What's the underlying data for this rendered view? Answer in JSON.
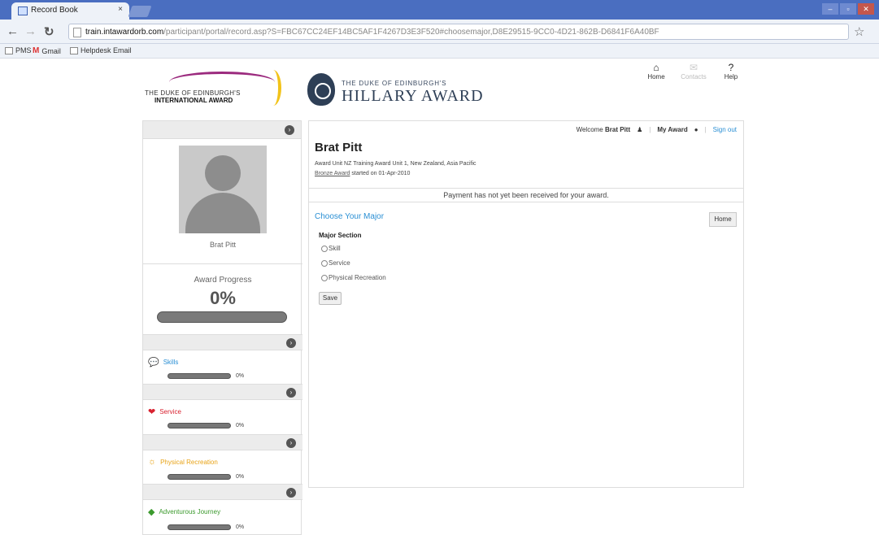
{
  "browser": {
    "tab_title": "Record Book",
    "tab_close": "×",
    "url_domain": "train.intawardorb.com",
    "url_path": "/participant/portal/record.asp?S=FBC67CC24EF14BC5AF1F4267D3E3F520#choosemajor,D8E29515-9CC0-4D21-862B-D6841F6A40BF",
    "bookmarks": [
      "PMS",
      "Gmail",
      "Helpdesk Email"
    ],
    "window_controls": [
      "–",
      "▫",
      "✕"
    ]
  },
  "header": {
    "left_logo_line1": "THE DUKE OF EDINBURGH'S",
    "left_logo_line2": "INTERNATIONAL AWARD",
    "right_logo_small": "THE DUKE OF EDINBURGH'S",
    "right_logo_big": "HILLARY AWARD",
    "nav": [
      {
        "label": "Home",
        "icon": "home-icon",
        "glyph": "⌂"
      },
      {
        "label": "Contacts",
        "icon": "contacts-icon",
        "glyph": "✉"
      },
      {
        "label": "Help",
        "icon": "help-icon",
        "glyph": "?"
      }
    ]
  },
  "sidebar": {
    "name": "Brat Pitt",
    "progress_title": "Award Progress",
    "progress_value": "0%",
    "progress_fraction": 0,
    "sections": [
      {
        "label": "Skills",
        "pct": "0%",
        "color": "#2a8fd4",
        "icon": "skills-icon",
        "glyph": "💬"
      },
      {
        "label": "Service",
        "pct": "0%",
        "color": "#d8212f",
        "icon": "service-icon",
        "glyph": "❤"
      },
      {
        "label": "Physical Recreation",
        "pct": "0%",
        "color": "#e8a317",
        "icon": "physical-recreation-icon",
        "glyph": "☼"
      },
      {
        "label": "Adventurous Journey",
        "pct": "0%",
        "color": "#3c9a2e",
        "icon": "adventurous-journey-icon",
        "glyph": "◆"
      }
    ]
  },
  "main": {
    "welcome_prefix": "Welcome",
    "welcome_name": "Brat Pitt",
    "my_award": "My Award",
    "sign_out": "Sign out",
    "name": "Brat Pitt",
    "unit": "Award Unit NZ Training Award Unit 1, New Zealand, Asia Pacific",
    "award_link": "Bronze Award",
    "started": " started on 01-Apr-2010",
    "payment": "Payment has not yet been received for your award.",
    "choose_title": "Choose Your Major",
    "home_button": "Home",
    "major_section": "Major Section",
    "options": [
      "Skill",
      "Service",
      "Physical Recreation"
    ],
    "save_button": "Save"
  }
}
